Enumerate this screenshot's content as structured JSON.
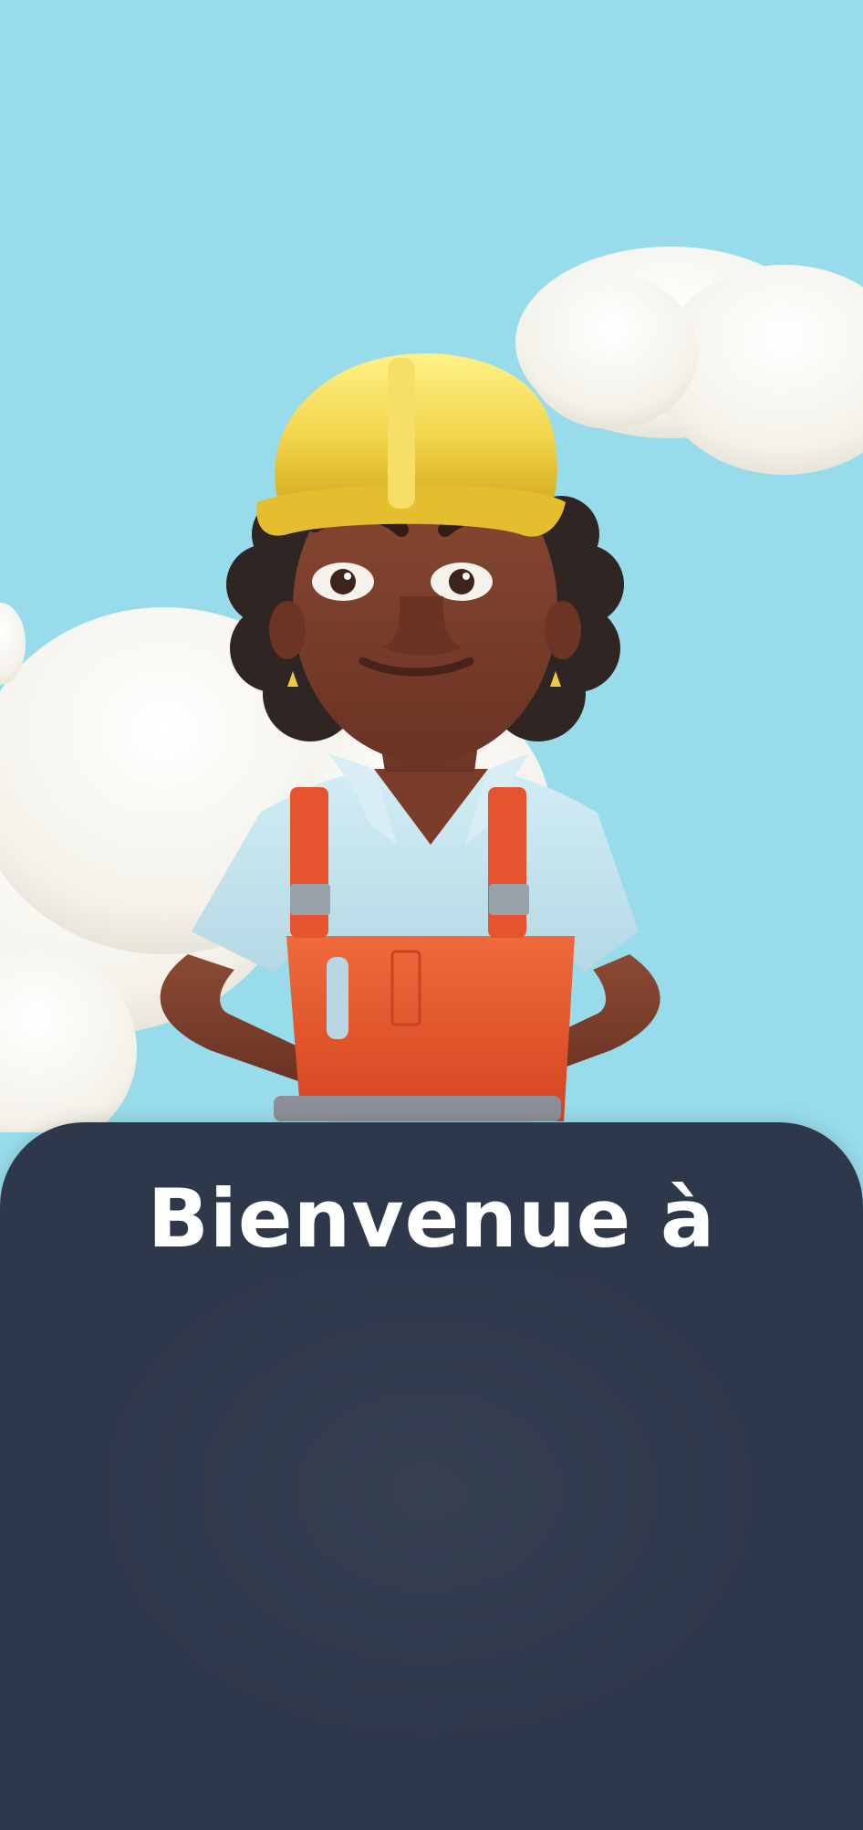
{
  "welcome": {
    "title": "Bienvenue à"
  },
  "illustration": {
    "subject": "construction-worker-woman",
    "colors": {
      "sky": "#98dbea",
      "cloud": "#f3f1e9",
      "helmet": "#f2d64b",
      "overalls": "#e5532f",
      "shirt": "#b9dbe6",
      "skin": "#7a3d2a"
    }
  },
  "sheet": {
    "color": "#2f384a"
  }
}
